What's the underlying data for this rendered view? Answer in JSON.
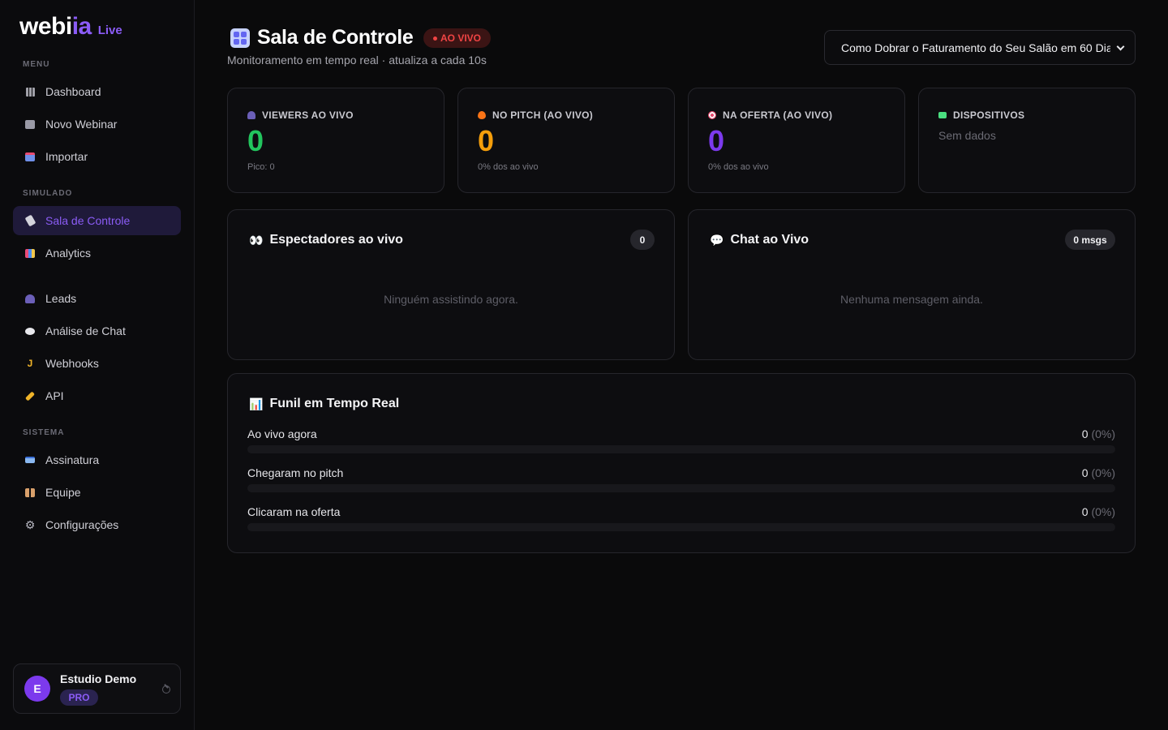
{
  "brand": {
    "logo_text_a": "webi",
    "logo_text_b": "ia",
    "logo_badge": "Live"
  },
  "colors": {
    "accent": "#8b5cf6",
    "live_red": "#f04444",
    "green": "#22c55e",
    "yellow": "#f59e0b",
    "purple": "#7c3aed"
  },
  "sidebar": {
    "sections": {
      "menu": "MENU",
      "simulado": "SIMULADO",
      "sistema": "SISTEMA"
    },
    "items": [
      {
        "label": "Dashboard",
        "icon": "grid-icon"
      },
      {
        "label": "Novo Webinar",
        "icon": "film-icon"
      },
      {
        "label": "Importar",
        "icon": "inbox-icon"
      },
      {
        "label": "Sala de Controle",
        "icon": "satellite-icon",
        "active": true
      },
      {
        "label": "Analytics",
        "icon": "bar-chart-icon"
      },
      {
        "label": "Leads",
        "icon": "users-icon"
      },
      {
        "label": "Análise de Chat",
        "icon": "speech-bubble-icon"
      },
      {
        "label": "Webhooks",
        "icon": "hook-icon"
      },
      {
        "label": "API",
        "icon": "key-icon"
      },
      {
        "label": "Assinatura",
        "icon": "credit-card-icon"
      },
      {
        "label": "Equipe",
        "icon": "team-icon"
      },
      {
        "label": "Configurações",
        "icon": "gear-icon"
      }
    ],
    "user": {
      "initial": "E",
      "name": "Estudio Demo",
      "plan": "PRO"
    }
  },
  "header": {
    "title": "Sala de Controle",
    "live_badge": "AO VIVO",
    "subtitle": "Monitoramento em tempo real · atualiza a cada 10s",
    "webinar_select": "Como Dobrar o Faturamento do Seu Salão em 60 Dias"
  },
  "stats": [
    {
      "label": "VIEWERS AO VIVO",
      "value": "0",
      "sub": "Pico: 0",
      "icon": "users-icon"
    },
    {
      "label": "NO PITCH (AO VIVO)",
      "value": "0",
      "sub": "0% dos ao vivo",
      "icon": "fire-icon"
    },
    {
      "label": "NA OFERTA (AO VIVO)",
      "value": "0",
      "sub": "0% dos ao vivo",
      "icon": "target-icon"
    },
    {
      "label": "DISPOSITIVOS",
      "empty": "Sem dados",
      "icon": "monitor-icon"
    }
  ],
  "viewers_panel": {
    "title": "Espectadores ao vivo",
    "count": "0",
    "empty": "Ninguém assistindo agora."
  },
  "chat_panel": {
    "title": "Chat ao Vivo",
    "count": "0 msgs",
    "empty": "Nenhuma mensagem ainda."
  },
  "funnel": {
    "title": "Funil em Tempo Real",
    "rows": [
      {
        "label": "Ao vivo agora",
        "value": "0",
        "pct": "(0%)",
        "fill": 0
      },
      {
        "label": "Chegaram no pitch",
        "value": "0",
        "pct": "(0%)",
        "fill": 0
      },
      {
        "label": "Clicaram na oferta",
        "value": "0",
        "pct": "(0%)",
        "fill": 0
      }
    ]
  }
}
